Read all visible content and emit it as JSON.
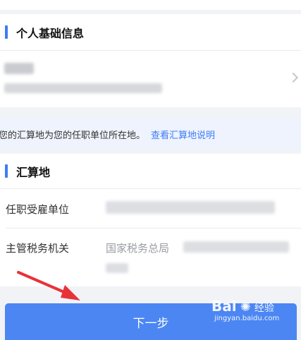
{
  "personal_section": {
    "title": "个人基础信息"
  },
  "notice": {
    "text": "您的汇算地为您的任职单位所在地。",
    "link": "查看汇算地说明"
  },
  "settlement_section": {
    "title": "汇算地",
    "employer_label": "任职受雇单位",
    "tax_authority_label": "主管税务机关",
    "tax_authority_value": "国家税务总局"
  },
  "next_button": {
    "label": "下一步"
  },
  "watermark": {
    "brand": "Bai",
    "brand_suffix": "经验",
    "site": "jingyan.baidu.com"
  },
  "colors": {
    "accent": "#3c7df5",
    "button": "#4b86f3",
    "page_bg": "#f2f3f7",
    "notice_bg": "#eef3fd",
    "arrow": "#e8323a"
  }
}
